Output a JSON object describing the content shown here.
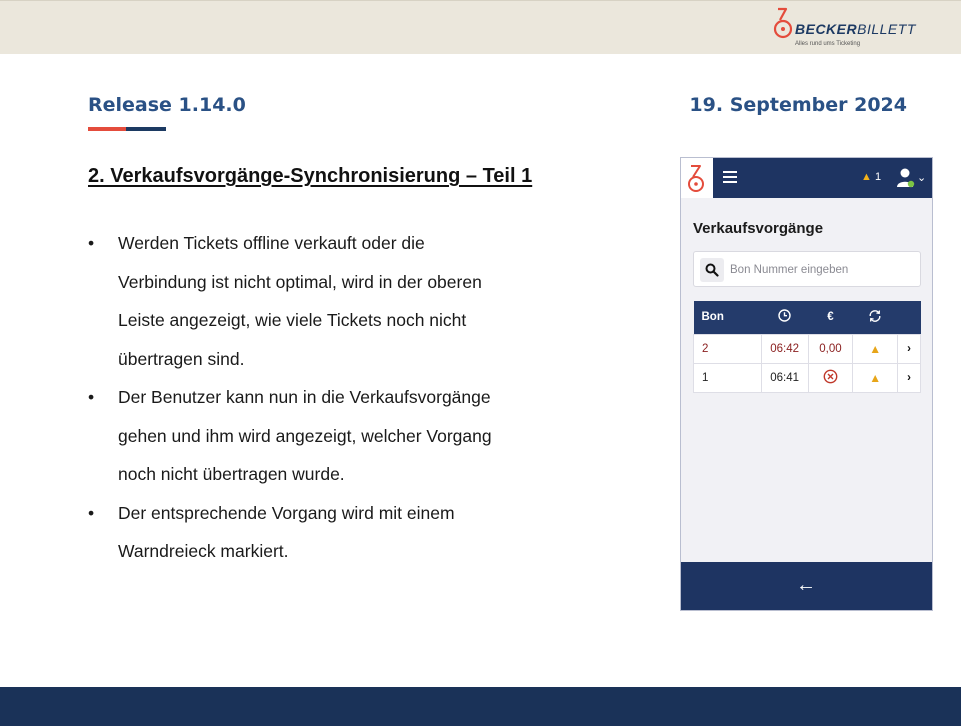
{
  "brand": {
    "name_bold": "BECKER",
    "name_rest": "BILLETT",
    "tagline": "Alles rund ums Ticketing"
  },
  "header": {
    "release": "Release 1.14.0",
    "date": "19. September 2024"
  },
  "section_title": "2. Verkaufsvorgänge-Synchronisierung – Teil 1",
  "bullets": [
    {
      "lines": [
        "Werden Tickets offline verkauft oder die",
        "Verbindung ist nicht optimal, wird in der oberen",
        "Leiste angezeigt, wie viele Tickets noch nicht",
        "übertragen sind."
      ]
    },
    {
      "lines": [
        "Der Benutzer kann nun in die Verkaufsvorgänge",
        "gehen und ihm wird angezeigt, welcher Vorgang",
        "noch nicht übertragen wurde."
      ]
    },
    {
      "lines": [
        "Der entsprechende Vorgang wird mit einem",
        "Warndreieck markiert."
      ]
    }
  ],
  "bullet_symbol": "•",
  "app": {
    "warning_count": "1",
    "page_title": "Verkaufsvorgänge",
    "search": {
      "placeholder": "Bon Nummer eingeben",
      "value": ""
    },
    "table": {
      "columns": [
        "Bon",
        "clock-icon",
        "euro-icon",
        "sync-icon"
      ],
      "rows": [
        {
          "bon": "2",
          "time": "06:42",
          "amount": "0,00",
          "status": "warning"
        },
        {
          "bon": "1",
          "time": "06:41",
          "amount": "",
          "status": "warning",
          "amount_icon": "cancel-circle-icon"
        }
      ]
    },
    "back_symbol": "←",
    "colors": {
      "navy": "#1e3462",
      "warning": "#e7a519",
      "pending_text": "#8a1f1f"
    }
  },
  "colors": {
    "title_blue": "#2a5185",
    "accent_red": "#e44c3c",
    "accent_navy": "#1c3a62",
    "top_band": "#ebe7dc",
    "bottom_band": "#1a3258"
  }
}
